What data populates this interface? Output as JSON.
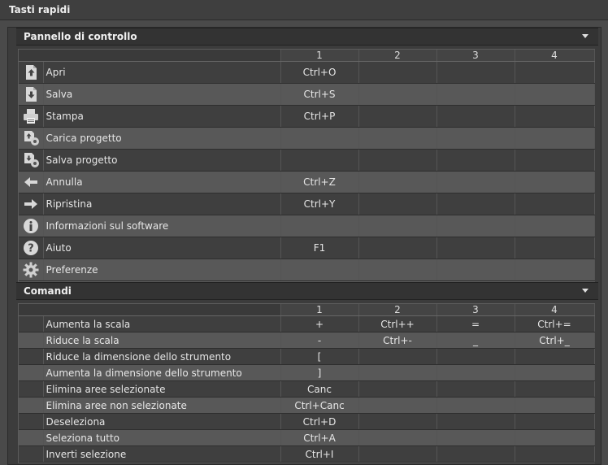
{
  "window": {
    "title": "Tasti rapidi"
  },
  "panel1": {
    "title": "Pannello di controllo",
    "columns": [
      "1",
      "2",
      "3",
      "4"
    ],
    "rows": [
      {
        "icon": "open-file-icon",
        "name": "Apri",
        "keys": [
          "Ctrl+O",
          "",
          "",
          ""
        ]
      },
      {
        "icon": "save-file-icon",
        "name": "Salva",
        "keys": [
          "Ctrl+S",
          "",
          "",
          ""
        ]
      },
      {
        "icon": "printer-icon",
        "name": "Stampa",
        "keys": [
          "Ctrl+P",
          "",
          "",
          ""
        ]
      },
      {
        "icon": "load-project-icon",
        "name": "Carica progetto",
        "keys": [
          "",
          "",
          "",
          ""
        ]
      },
      {
        "icon": "save-project-icon",
        "name": "Salva progetto",
        "keys": [
          "",
          "",
          "",
          ""
        ]
      },
      {
        "icon": "undo-arrow-icon",
        "name": "Annulla",
        "keys": [
          "Ctrl+Z",
          "",
          "",
          ""
        ]
      },
      {
        "icon": "redo-arrow-icon",
        "name": "Ripristina",
        "keys": [
          "Ctrl+Y",
          "",
          "",
          ""
        ]
      },
      {
        "icon": "info-icon",
        "name": "Informazioni sul software",
        "keys": [
          "",
          "",
          "",
          ""
        ]
      },
      {
        "icon": "help-icon",
        "name": "Aiuto",
        "keys": [
          "F1",
          "",
          "",
          ""
        ]
      },
      {
        "icon": "gear-icon",
        "name": "Preferenze",
        "keys": [
          "",
          "",
          "",
          ""
        ]
      }
    ]
  },
  "panel2": {
    "title": "Comandi",
    "columns": [
      "1",
      "2",
      "3",
      "4"
    ],
    "rows": [
      {
        "name": "Aumenta la scala",
        "keys": [
          "+",
          "Ctrl++",
          "=",
          "Ctrl+="
        ]
      },
      {
        "name": "Riduce la scala",
        "keys": [
          "-",
          "Ctrl+-",
          "_",
          "Ctrl+_"
        ]
      },
      {
        "name": "Riduce la dimensione dello strumento",
        "keys": [
          "[",
          "",
          "",
          ""
        ]
      },
      {
        "name": "Aumenta la dimensione dello strumento",
        "keys": [
          "]",
          "",
          "",
          ""
        ]
      },
      {
        "name": "Elimina aree selezionate",
        "keys": [
          "Canc",
          "",
          "",
          ""
        ]
      },
      {
        "name": "Elimina aree non selezionate",
        "keys": [
          "Ctrl+Canc",
          "",
          "",
          ""
        ]
      },
      {
        "name": "Deseleziona",
        "keys": [
          "Ctrl+D",
          "",
          "",
          ""
        ]
      },
      {
        "name": "Seleziona tutto",
        "keys": [
          "Ctrl+A",
          "",
          "",
          ""
        ]
      },
      {
        "name": "Inverti selezione",
        "keys": [
          "Ctrl+I",
          "",
          "",
          ""
        ]
      }
    ]
  }
}
